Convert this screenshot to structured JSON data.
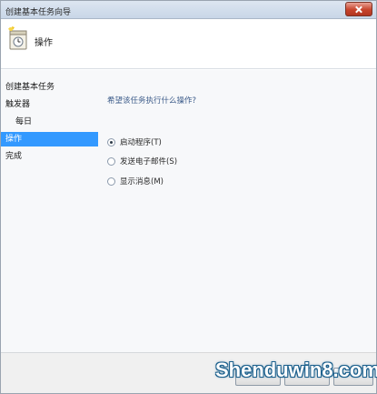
{
  "window": {
    "title": "创建基本任务向导"
  },
  "header": {
    "title": "操作",
    "icon": "task-scheduler-icon"
  },
  "sidebar": {
    "items": [
      {
        "label": "创建基本任务",
        "active": false,
        "sub": false
      },
      {
        "label": "触发器",
        "active": false,
        "sub": false
      },
      {
        "label": "每日",
        "active": false,
        "sub": true
      },
      {
        "label": "操作",
        "active": true,
        "sub": false
      },
      {
        "label": "完成",
        "active": false,
        "sub": false
      }
    ]
  },
  "main": {
    "question": "希望该任务执行什么操作?",
    "options": [
      {
        "label": "启动程序(T)",
        "checked": true
      },
      {
        "label": "发送电子邮件(S)",
        "checked": false
      },
      {
        "label": "显示消息(M)",
        "checked": false
      }
    ]
  },
  "watermark": {
    "text": "Shenduwin8.com"
  },
  "colors": {
    "selection": "#3399ff",
    "question_text": "#3d5c8a",
    "close_button": "#c7442c"
  }
}
